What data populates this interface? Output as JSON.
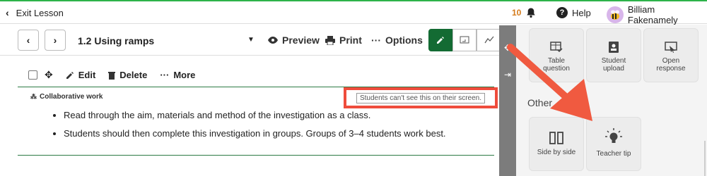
{
  "topbar": {
    "exit_label": "Exit Lesson",
    "notification_count": "10",
    "help_label": "Help",
    "user_name": "Billiam Fakenamely"
  },
  "lessonbar": {
    "title": "1.2 Using ramps",
    "preview_label": "Preview",
    "print_label": "Print",
    "options_label": "Options"
  },
  "edit_toolbar": {
    "edit_label": "Edit",
    "delete_label": "Delete",
    "more_label": "More"
  },
  "block": {
    "type_label": "Collaborative work",
    "hint": "Students can't see this on their screen.",
    "bullets": [
      "Read through the aim, materials and method of the investigation as a class.",
      "Students should then complete this investigation in groups. Groups of 3–4 students work best."
    ]
  },
  "panel": {
    "cards_top": [
      {
        "label": "Table\nquestion",
        "icon": "table-check-icon"
      },
      {
        "label": "Student\nupload",
        "icon": "student-upload-icon"
      },
      {
        "label": "Open\nresponse",
        "icon": "open-response-icon"
      }
    ],
    "other_label": "Other",
    "cards_other": [
      {
        "label": "Side by side",
        "icon": "side-by-side-icon"
      },
      {
        "label": "Teacher tip",
        "icon": "lightbulb-icon"
      }
    ]
  },
  "colors": {
    "accent_green": "#136b33",
    "highlight_red": "#ef4c3c",
    "top_line": "#2db34a"
  }
}
